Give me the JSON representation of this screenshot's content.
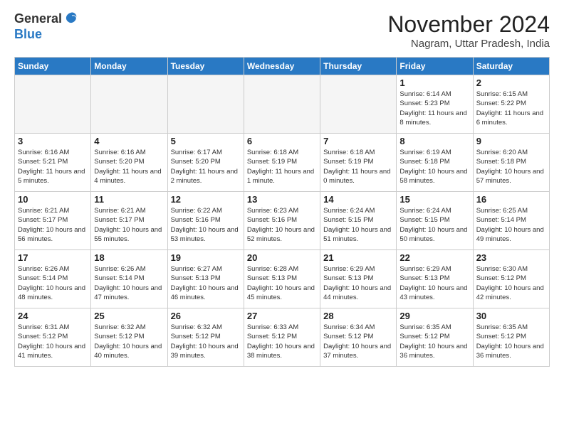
{
  "logo": {
    "general": "General",
    "blue": "Blue"
  },
  "title": "November 2024",
  "subtitle": "Nagram, Uttar Pradesh, India",
  "headers": [
    "Sunday",
    "Monday",
    "Tuesday",
    "Wednesday",
    "Thursday",
    "Friday",
    "Saturday"
  ],
  "weeks": [
    [
      {
        "day": "",
        "empty": true
      },
      {
        "day": "",
        "empty": true
      },
      {
        "day": "",
        "empty": true
      },
      {
        "day": "",
        "empty": true
      },
      {
        "day": "",
        "empty": true
      },
      {
        "day": "1",
        "sunrise": "6:14 AM",
        "sunset": "5:23 PM",
        "daylight": "11 hours and 8 minutes."
      },
      {
        "day": "2",
        "sunrise": "6:15 AM",
        "sunset": "5:22 PM",
        "daylight": "11 hours and 6 minutes."
      }
    ],
    [
      {
        "day": "3",
        "sunrise": "6:16 AM",
        "sunset": "5:21 PM",
        "daylight": "11 hours and 5 minutes."
      },
      {
        "day": "4",
        "sunrise": "6:16 AM",
        "sunset": "5:20 PM",
        "daylight": "11 hours and 4 minutes."
      },
      {
        "day": "5",
        "sunrise": "6:17 AM",
        "sunset": "5:20 PM",
        "daylight": "11 hours and 2 minutes."
      },
      {
        "day": "6",
        "sunrise": "6:18 AM",
        "sunset": "5:19 PM",
        "daylight": "11 hours and 1 minute."
      },
      {
        "day": "7",
        "sunrise": "6:18 AM",
        "sunset": "5:19 PM",
        "daylight": "11 hours and 0 minutes."
      },
      {
        "day": "8",
        "sunrise": "6:19 AM",
        "sunset": "5:18 PM",
        "daylight": "10 hours and 58 minutes."
      },
      {
        "day": "9",
        "sunrise": "6:20 AM",
        "sunset": "5:18 PM",
        "daylight": "10 hours and 57 minutes."
      }
    ],
    [
      {
        "day": "10",
        "sunrise": "6:21 AM",
        "sunset": "5:17 PM",
        "daylight": "10 hours and 56 minutes."
      },
      {
        "day": "11",
        "sunrise": "6:21 AM",
        "sunset": "5:17 PM",
        "daylight": "10 hours and 55 minutes."
      },
      {
        "day": "12",
        "sunrise": "6:22 AM",
        "sunset": "5:16 PM",
        "daylight": "10 hours and 53 minutes."
      },
      {
        "day": "13",
        "sunrise": "6:23 AM",
        "sunset": "5:16 PM",
        "daylight": "10 hours and 52 minutes."
      },
      {
        "day": "14",
        "sunrise": "6:24 AM",
        "sunset": "5:15 PM",
        "daylight": "10 hours and 51 minutes."
      },
      {
        "day": "15",
        "sunrise": "6:24 AM",
        "sunset": "5:15 PM",
        "daylight": "10 hours and 50 minutes."
      },
      {
        "day": "16",
        "sunrise": "6:25 AM",
        "sunset": "5:14 PM",
        "daylight": "10 hours and 49 minutes."
      }
    ],
    [
      {
        "day": "17",
        "sunrise": "6:26 AM",
        "sunset": "5:14 PM",
        "daylight": "10 hours and 48 minutes."
      },
      {
        "day": "18",
        "sunrise": "6:26 AM",
        "sunset": "5:14 PM",
        "daylight": "10 hours and 47 minutes."
      },
      {
        "day": "19",
        "sunrise": "6:27 AM",
        "sunset": "5:13 PM",
        "daylight": "10 hours and 46 minutes."
      },
      {
        "day": "20",
        "sunrise": "6:28 AM",
        "sunset": "5:13 PM",
        "daylight": "10 hours and 45 minutes."
      },
      {
        "day": "21",
        "sunrise": "6:29 AM",
        "sunset": "5:13 PM",
        "daylight": "10 hours and 44 minutes."
      },
      {
        "day": "22",
        "sunrise": "6:29 AM",
        "sunset": "5:13 PM",
        "daylight": "10 hours and 43 minutes."
      },
      {
        "day": "23",
        "sunrise": "6:30 AM",
        "sunset": "5:12 PM",
        "daylight": "10 hours and 42 minutes."
      }
    ],
    [
      {
        "day": "24",
        "sunrise": "6:31 AM",
        "sunset": "5:12 PM",
        "daylight": "10 hours and 41 minutes."
      },
      {
        "day": "25",
        "sunrise": "6:32 AM",
        "sunset": "5:12 PM",
        "daylight": "10 hours and 40 minutes."
      },
      {
        "day": "26",
        "sunrise": "6:32 AM",
        "sunset": "5:12 PM",
        "daylight": "10 hours and 39 minutes."
      },
      {
        "day": "27",
        "sunrise": "6:33 AM",
        "sunset": "5:12 PM",
        "daylight": "10 hours and 38 minutes."
      },
      {
        "day": "28",
        "sunrise": "6:34 AM",
        "sunset": "5:12 PM",
        "daylight": "10 hours and 37 minutes."
      },
      {
        "day": "29",
        "sunrise": "6:35 AM",
        "sunset": "5:12 PM",
        "daylight": "10 hours and 36 minutes."
      },
      {
        "day": "30",
        "sunrise": "6:35 AM",
        "sunset": "5:12 PM",
        "daylight": "10 hours and 36 minutes."
      }
    ]
  ]
}
